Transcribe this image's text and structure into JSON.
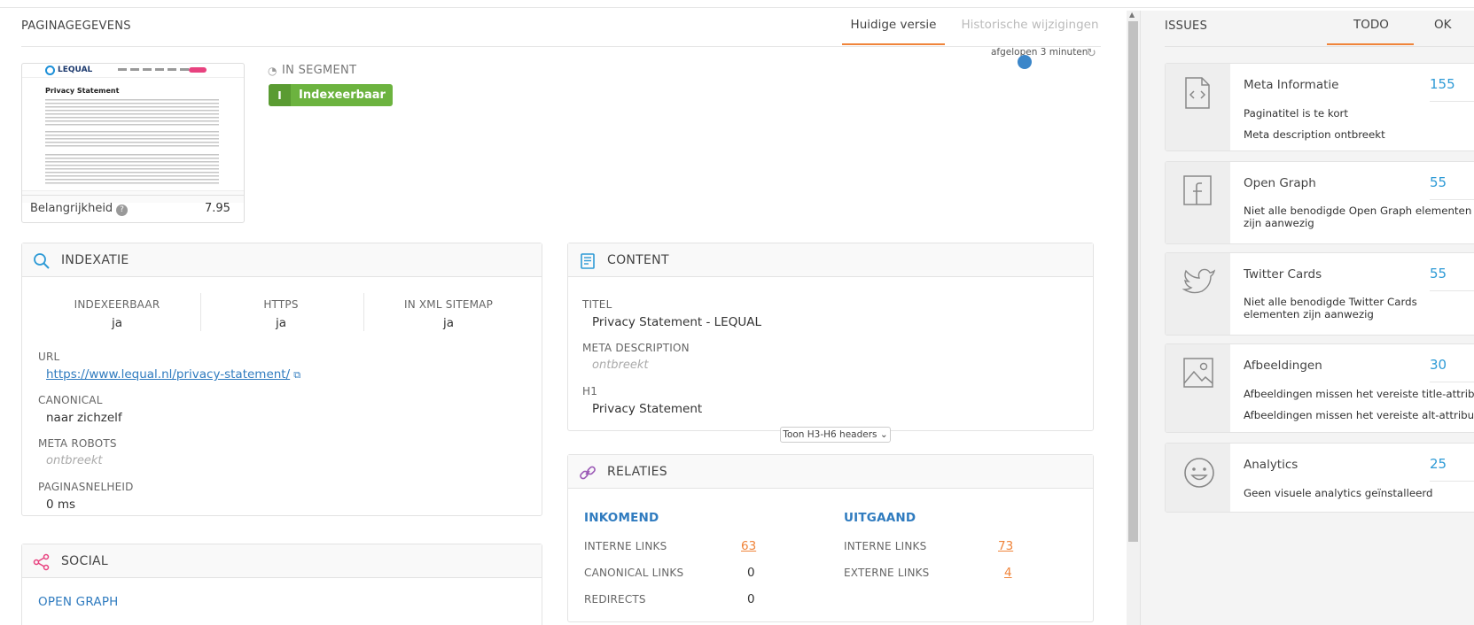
{
  "header": {
    "title": "PAGINAGEGEVENS",
    "tabs": [
      {
        "label": "Huidige versie",
        "active": true
      },
      {
        "label": "Historische wijzigingen",
        "active": false
      }
    ],
    "status": "afgelopen 3 minuten"
  },
  "thumbnail": {
    "logo": "LEQUAL",
    "page_heading": "Privacy Statement"
  },
  "importance": {
    "label": "Belangrijkheid",
    "help": "?",
    "value": "7.95"
  },
  "segment": {
    "label": "IN SEGMENT",
    "badge_letter": "I",
    "badge_text": "Indexeerbaar",
    "badge_color": "#6cb33f"
  },
  "indexatie": {
    "title": "INDEXATIE",
    "columns": [
      {
        "label": "INDEXEERBAAR",
        "value": "ja"
      },
      {
        "label": "HTTPS",
        "value": "ja"
      },
      {
        "label": "IN XML SITEMAP",
        "value": "ja"
      }
    ],
    "url_label": "URL",
    "url": "https://www.lequal.nl/privacy-statement/",
    "canonical_label": "CANONICAL",
    "canonical": "naar zichzelf",
    "meta_robots_label": "META ROBOTS",
    "meta_robots": "ontbreekt",
    "speed_label": "PAGINASNELHEID",
    "speed": "0 ms"
  },
  "content": {
    "title": "CONTENT",
    "titel_label": "TITEL",
    "titel": "Privacy Statement - LEQUAL",
    "meta_desc_label": "META DESCRIPTION",
    "meta_desc": "ontbreekt",
    "h1_label": "H1",
    "h1": "Privacy Statement",
    "toggle": "Toon H3-H6 headers"
  },
  "social": {
    "title": "SOCIAL",
    "open_graph": "OPEN GRAPH"
  },
  "relaties": {
    "title": "RELATIES",
    "incoming": {
      "title": "INKOMEND",
      "rows": [
        {
          "label": "INTERNE LINKS",
          "value": "63",
          "highlight": true
        },
        {
          "label": "CANONICAL LINKS",
          "value": "0",
          "highlight": false
        },
        {
          "label": "REDIRECTS",
          "value": "0",
          "highlight": false
        }
      ]
    },
    "outgoing": {
      "title": "UITGAAND",
      "rows": [
        {
          "label": "INTERNE LINKS",
          "value": "73",
          "highlight": true
        },
        {
          "label": "EXTERNE LINKS",
          "value": "4",
          "highlight": true
        }
      ]
    }
  },
  "issues": {
    "title": "ISSUES",
    "tabs": [
      {
        "label": "TODO",
        "active": true
      },
      {
        "label": "OK",
        "active": false
      }
    ],
    "items": [
      {
        "icon": "code-file-icon",
        "title": "Meta Informatie",
        "count": "155",
        "messages": [
          "Paginatitel is te kort",
          "Meta description ontbreekt"
        ]
      },
      {
        "icon": "facebook-icon",
        "title": "Open Graph",
        "count": "55",
        "messages": [
          "Niet alle benodigde Open Graph elementen zijn aanwezig"
        ]
      },
      {
        "icon": "twitter-icon",
        "title": "Twitter Cards",
        "count": "55",
        "messages": [
          "Niet alle benodigde Twitter Cards elementen zijn aanwezig"
        ]
      },
      {
        "icon": "image-icon",
        "title": "Afbeeldingen",
        "count": "30",
        "messages": [
          "Afbeeldingen missen het vereiste title-attribuut",
          "Afbeeldingen missen het vereiste alt-attribuut"
        ]
      },
      {
        "icon": "smiley-icon",
        "title": "Analytics",
        "count": "25",
        "messages": [
          "Geen visuele analytics geïnstalleerd"
        ]
      }
    ]
  }
}
